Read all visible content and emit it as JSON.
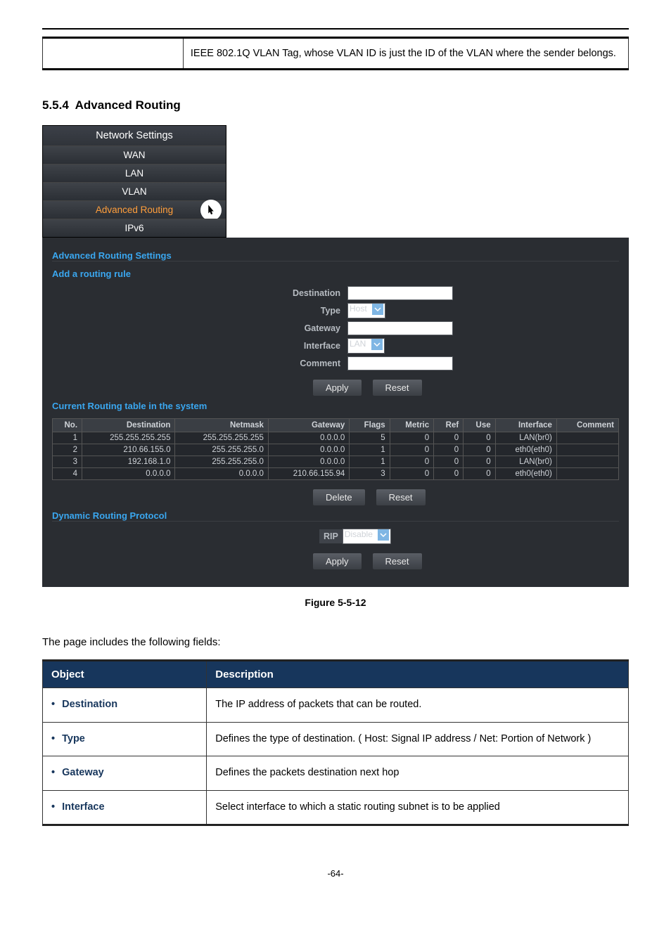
{
  "vlan_note": "IEEE 802.1Q VLAN Tag, whose VLAN ID is just the ID of the VLAN where the sender belongs.",
  "section_number": "5.5.4",
  "section_title": "Advanced Routing",
  "nav": {
    "header": "Network Settings",
    "items": [
      "WAN",
      "LAN",
      "VLAN",
      "Advanced Routing",
      "IPv6"
    ],
    "selected_index": 3
  },
  "adv_routing": {
    "title": "Advanced Routing Settings",
    "add_rule_title": "Add a routing rule",
    "labels": {
      "destination": "Destination",
      "type": "Type",
      "gateway": "Gateway",
      "interface": "Interface",
      "comment": "Comment"
    },
    "values": {
      "type": "Host",
      "interface": "LAN"
    },
    "buttons": {
      "apply": "Apply",
      "reset": "Reset",
      "delete": "Delete"
    }
  },
  "routing_table": {
    "title": "Current Routing table in the system",
    "headers": [
      "No.",
      "Destination",
      "Netmask",
      "Gateway",
      "Flags",
      "Metric",
      "Ref",
      "Use",
      "Interface",
      "Comment"
    ],
    "rows": [
      {
        "no": "1",
        "dest": "255.255.255.255",
        "mask": "255.255.255.255",
        "gw": "0.0.0.0",
        "flags": "5",
        "metric": "0",
        "ref": "0",
        "use": "0",
        "iface": "LAN(br0)",
        "comment": ""
      },
      {
        "no": "2",
        "dest": "210.66.155.0",
        "mask": "255.255.255.0",
        "gw": "0.0.0.0",
        "flags": "1",
        "metric": "0",
        "ref": "0",
        "use": "0",
        "iface": "eth0(eth0)",
        "comment": ""
      },
      {
        "no": "3",
        "dest": "192.168.1.0",
        "mask": "255.255.255.0",
        "gw": "0.0.0.0",
        "flags": "1",
        "metric": "0",
        "ref": "0",
        "use": "0",
        "iface": "LAN(br0)",
        "comment": ""
      },
      {
        "no": "4",
        "dest": "0.0.0.0",
        "mask": "0.0.0.0",
        "gw": "210.66.155.94",
        "flags": "3",
        "metric": "0",
        "ref": "0",
        "use": "0",
        "iface": "eth0(eth0)",
        "comment": ""
      }
    ]
  },
  "dynamic_routing": {
    "title": "Dynamic Routing Protocol",
    "rip_label": "RIP",
    "rip_value": "Disable"
  },
  "figure_caption": "Figure 5-5-12",
  "intro": "The page includes the following fields:",
  "fields_table": {
    "headers": {
      "object": "Object",
      "description": "Description"
    },
    "rows": [
      {
        "object": "Destination",
        "desc": "The IP address of packets that can be routed."
      },
      {
        "object": "Type",
        "desc": "Defines the type of destination. ( Host: Signal IP address / Net: Portion of Network )"
      },
      {
        "object": "Gateway",
        "desc": "Defines the packets destination next hop"
      },
      {
        "object": "Interface",
        "desc": "Select interface to which a static routing subnet is to be applied"
      }
    ]
  },
  "page_number": "-64-"
}
